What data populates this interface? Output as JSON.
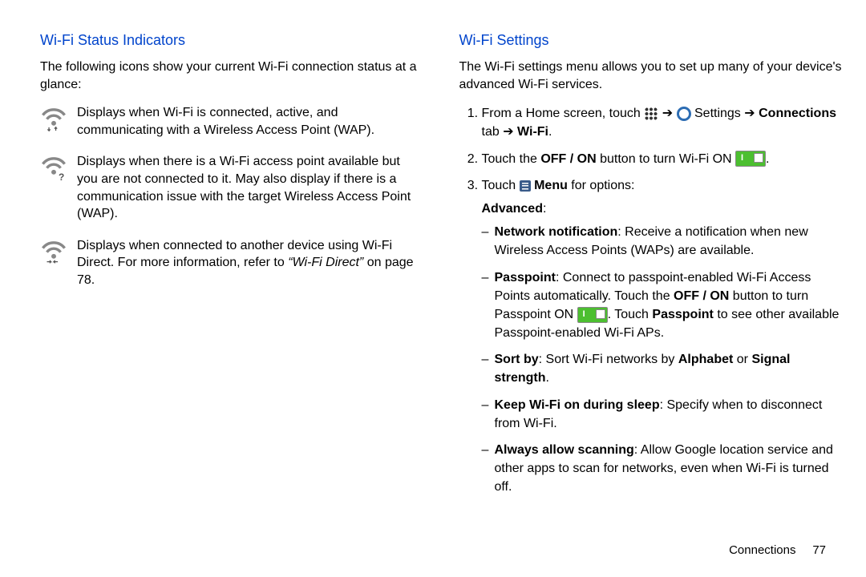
{
  "left": {
    "heading": "Wi-Fi Status Indicators",
    "intro": "The following icons show your current Wi-Fi connection status at a glance:",
    "rows": [
      {
        "desc": "Displays when Wi-Fi is connected, active, and communicating with a Wireless Access Point (WAP)."
      },
      {
        "desc": "Displays when there is a Wi-Fi access point available but you are not connected to it. May also display if there is a communication issue with the target Wireless Access Point (WAP)."
      },
      {
        "desc_pre": "Displays when connected to another device using Wi-Fi Direct. For more information, refer to ",
        "desc_link": "“Wi-Fi Direct”",
        "desc_post": " on page 78."
      }
    ]
  },
  "right": {
    "heading": "Wi-Fi Settings",
    "intro": "The Wi-Fi settings menu allows you to set up many of your device's advanced Wi-Fi services.",
    "step1_pre": "From a Home screen, touch ",
    "step1_arrow": " ➔ ",
    "step1_settings": " Settings ➔ ",
    "step1_conn": "Connections",
    "step1_tab": " tab ➔ ",
    "step1_wifi": "Wi-Fi",
    "step2_pre": "Touch the ",
    "step2_btn": "OFF / ON",
    "step2_mid": " button to turn Wi-Fi ON ",
    "step2_end": ".",
    "step3_pre": "Touch ",
    "step3_menu": " Menu",
    "step3_post": " for options:",
    "advhead": "Advanced",
    "sub": [
      {
        "bold": "Network notification",
        "text": ": Receive a notification when new Wireless Access Points (WAPs) are available."
      },
      {
        "bold": "Passpoint",
        "t1": ": Connect to passpoint-enabled Wi-Fi Access Points automatically. Touch the ",
        "btn": "OFF / ON",
        "t2": " button to turn Passpoint ON ",
        "t3": ". Touch ",
        "bold2": "Passpoint",
        "t4": " to see other available Passpoint-enabled Wi-Fi APs."
      },
      {
        "bold": "Sort by",
        "t1": ": Sort Wi-Fi networks by ",
        "b2": "Alphabet",
        "t2": " or ",
        "b3": "Signal strength",
        "t3": "."
      },
      {
        "bold": "Keep Wi-Fi on during sleep",
        "text": ": Specify when to disconnect from Wi-Fi."
      },
      {
        "bold": "Always allow scanning",
        "text": ": Allow Google location service and other apps to scan for networks, even when Wi-Fi is turned off."
      }
    ]
  },
  "footer": {
    "section": "Connections",
    "page": "77"
  }
}
